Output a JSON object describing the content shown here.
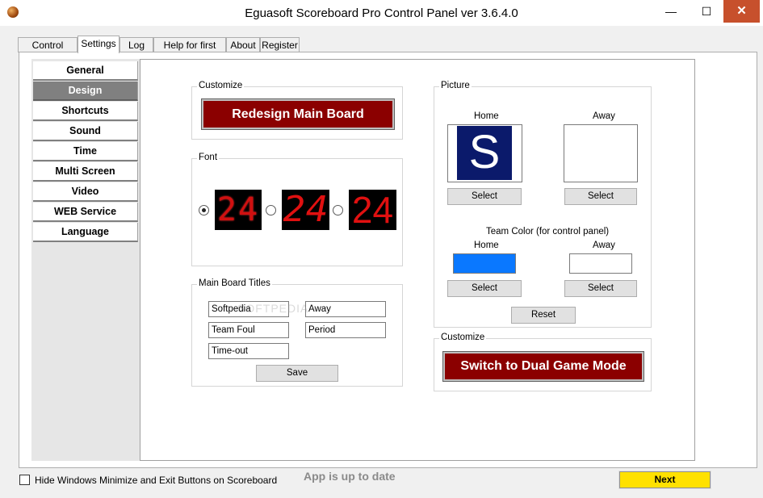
{
  "window": {
    "title": "Eguasoft Scoreboard Pro Control Panel ver 3.6.4.0",
    "close_glyph": "✕",
    "minimize_glyph": "—",
    "maximize_glyph": "☐"
  },
  "tabs": [
    "Control Panel",
    "Settings",
    "Log",
    "Help for first step",
    "About",
    "Register"
  ],
  "sidebar": [
    "General",
    "Design",
    "Shortcuts",
    "Sound",
    "Time",
    "Multi Screen",
    "Video",
    "WEB Service",
    "Language"
  ],
  "customize": {
    "label": "Customize",
    "button": "Redesign Main Board"
  },
  "font": {
    "label": "Font",
    "sample1": "24",
    "sample2": "24",
    "sample3": "24"
  },
  "titles": {
    "label": "Main Board Titles",
    "home": "Softpedia",
    "away": "Away",
    "team_foul": "Team Foul",
    "period": "Period",
    "timeout": "Time-out",
    "save": "Save"
  },
  "picture": {
    "label": "Picture",
    "home": "Home",
    "away": "Away",
    "logo_letter": "S",
    "select": "Select",
    "team_color_label": "Team Color (for control panel)",
    "reset": "Reset"
  },
  "customize2": {
    "label": "Customize",
    "button": "Switch to Dual Game Mode"
  },
  "colors": {
    "home": "#0a78ff",
    "away": "#ffffff",
    "accent_red": "#8b0000",
    "next": "#ffe100"
  },
  "footer": {
    "checkbox_label": "Hide Windows Minimize and Exit Buttons on Scoreboard",
    "status": "App is up to date",
    "next": "Next"
  },
  "watermark": "SOFTPEDIA"
}
